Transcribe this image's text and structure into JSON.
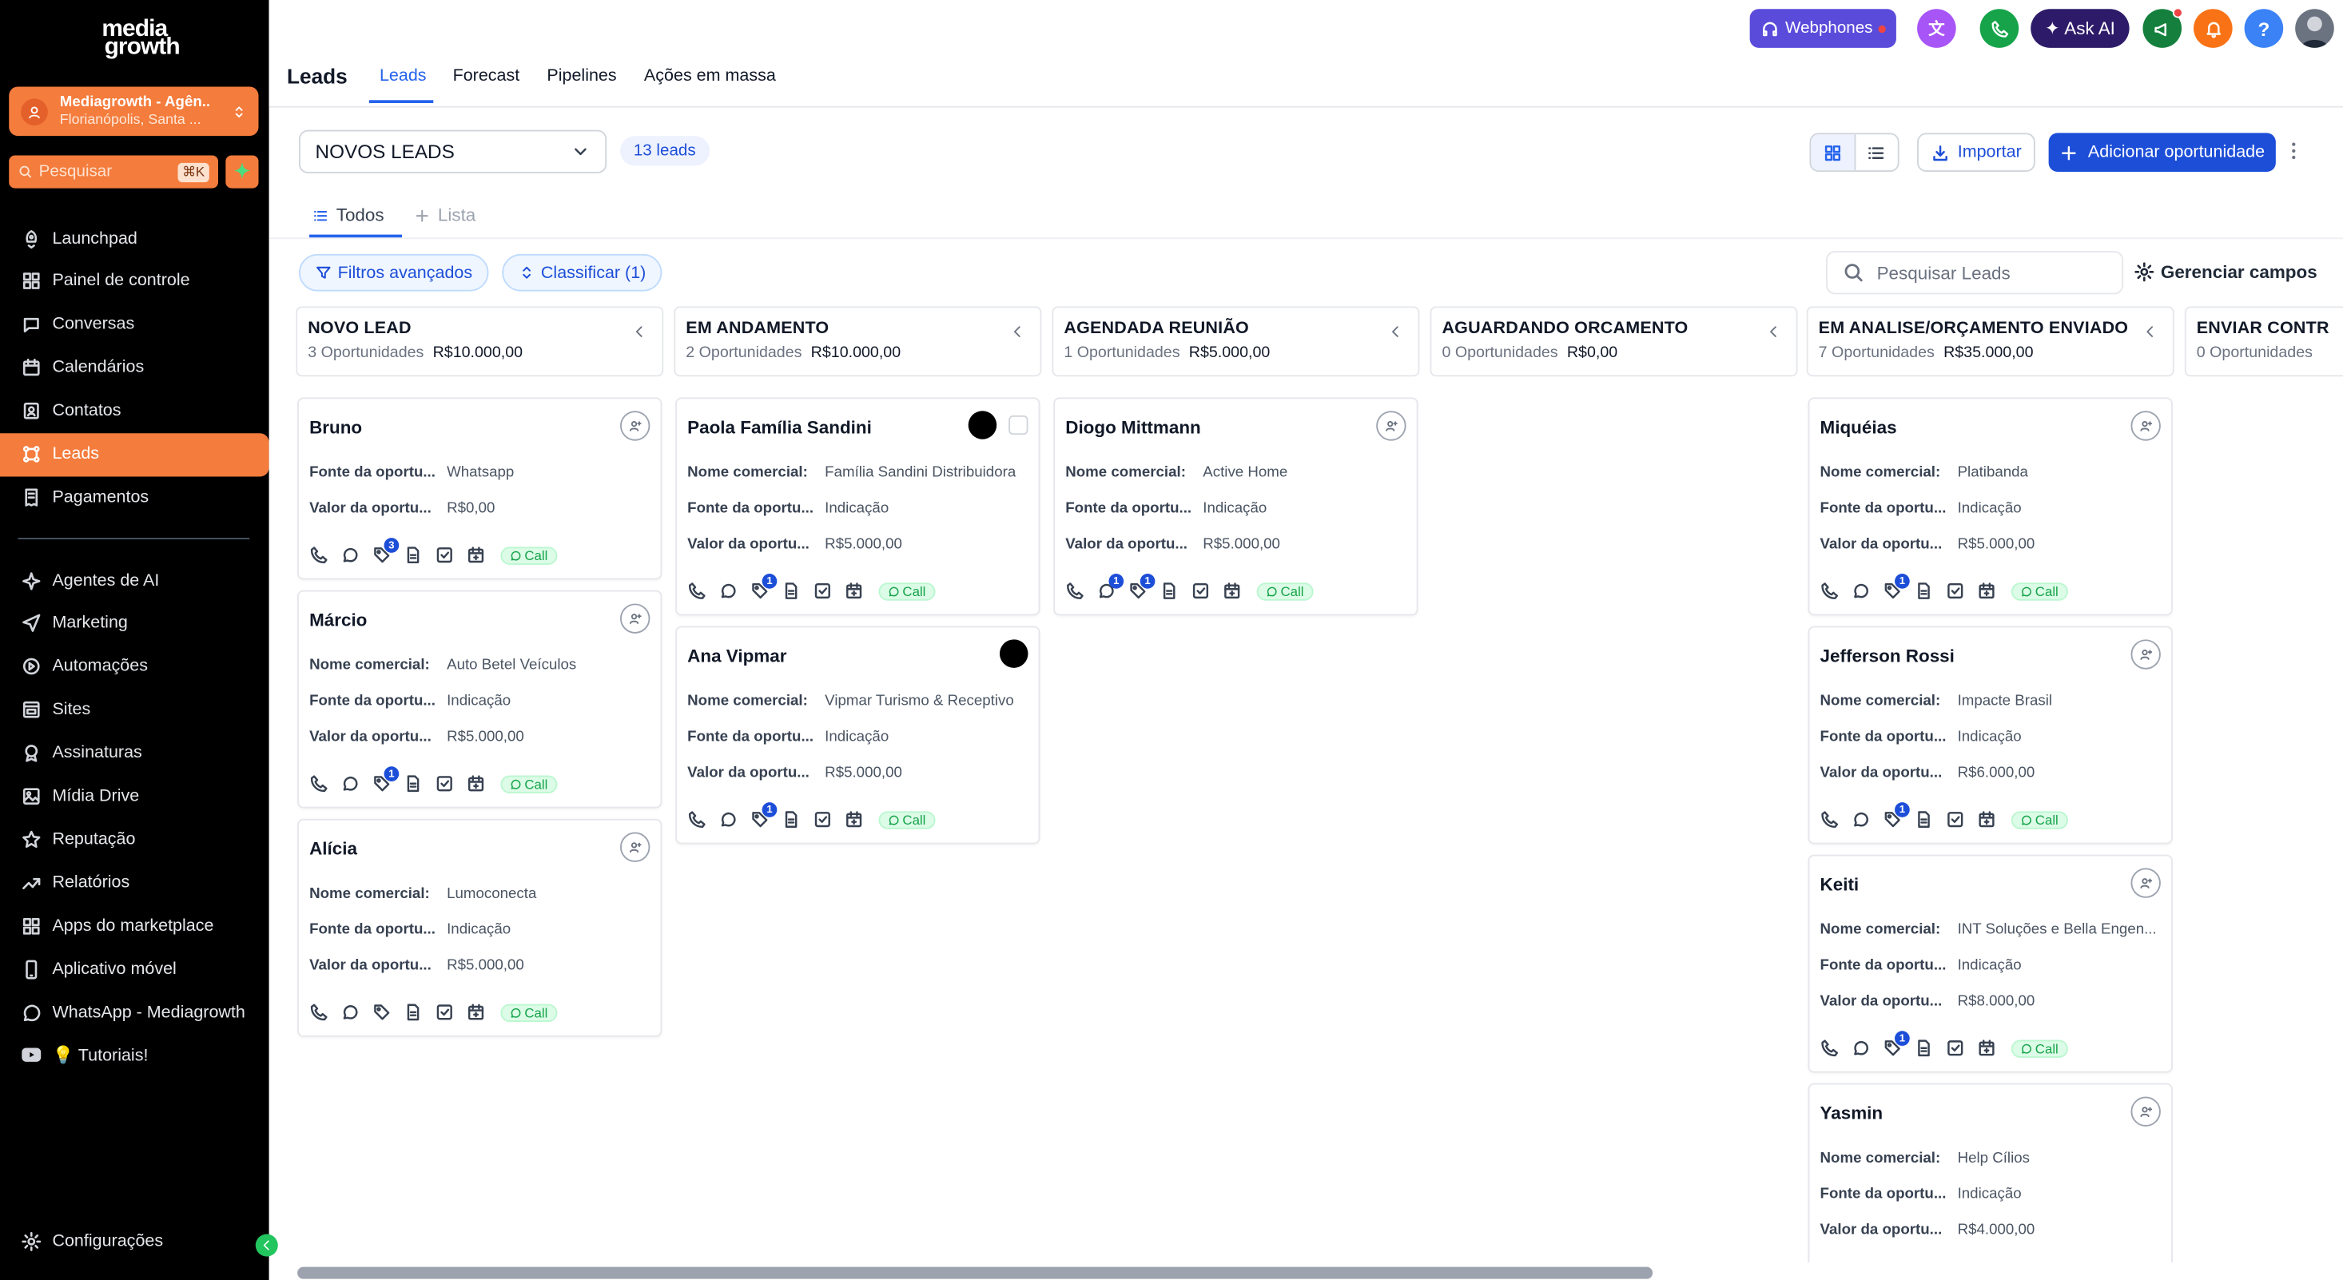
{
  "brand": {
    "line1": "media",
    "line2": "growth"
  },
  "account": {
    "name": "Mediagrowth - Agên...",
    "location": "Florianópolis, Santa ..."
  },
  "sidebar_search": {
    "placeholder": "Pesquisar",
    "shortcut": "⌘K"
  },
  "nav_top": [
    {
      "label": "Launchpad",
      "icon": "rocket-icon"
    },
    {
      "label": "Painel de controle",
      "icon": "grid-icon"
    },
    {
      "label": "Conversas",
      "icon": "chat-icon"
    },
    {
      "label": "Calendários",
      "icon": "calendar-icon"
    },
    {
      "label": "Contatos",
      "icon": "contacts-icon"
    },
    {
      "label": "Leads",
      "icon": "funnel-icon",
      "active": true
    },
    {
      "label": "Pagamentos",
      "icon": "receipt-icon"
    }
  ],
  "nav_bottom": [
    {
      "label": "Agentes de AI",
      "icon": "sparkle-icon"
    },
    {
      "label": "Marketing",
      "icon": "send-icon"
    },
    {
      "label": "Automações",
      "icon": "automation-icon"
    },
    {
      "label": "Sites",
      "icon": "sites-icon"
    },
    {
      "label": "Assinaturas",
      "icon": "badge-icon"
    },
    {
      "label": "Mídia Drive",
      "icon": "image-icon"
    },
    {
      "label": "Reputação",
      "icon": "star-icon"
    },
    {
      "label": "Relatórios",
      "icon": "trend-icon"
    },
    {
      "label": "Apps do marketplace",
      "icon": "apps-icon"
    },
    {
      "label": "Aplicativo móvel",
      "icon": "phone-device-icon"
    },
    {
      "label": "WhatsApp - Mediagrowth",
      "icon": "whatsapp-icon"
    },
    {
      "label": "💡 Tutoriais!",
      "icon": "youtube-icon"
    }
  ],
  "settings_label": "Configurações",
  "header": {
    "title": "Leads",
    "tabs": [
      "Leads",
      "Forecast",
      "Pipelines",
      "Ações em massa"
    ],
    "active_tab": "Leads"
  },
  "topbar": {
    "webphones": "Webphones",
    "ask_ai": "Ask AI"
  },
  "pipeline": {
    "selected": "NOVOS LEADS",
    "count": "13 leads"
  },
  "actions": {
    "import": "Importar",
    "add": "Adicionar oportunidade"
  },
  "subtabs": {
    "all": "Todos",
    "list": "Lista"
  },
  "filters": {
    "advanced": "Filtros avançados",
    "sort": "Classificar (1)"
  },
  "search_leads": {
    "placeholder": "Pesquisar Leads"
  },
  "manage_fields": "Gerenciar campos",
  "labels": {
    "nome": "Nome comercial:",
    "fonte": "Fonte da oportu...",
    "valor": "Valor da oportu...",
    "call": "Call"
  },
  "columns": [
    {
      "name": "NOVO LEAD",
      "count": "3 Oportunidades",
      "total": "R$10.000,00",
      "cards": [
        {
          "name": "Bruno",
          "fonte": "Whatsapp",
          "valor": "R$0,00",
          "tags_count": "3"
        },
        {
          "name": "Márcio",
          "nome": "Auto Betel Veículos",
          "fonte": "Indicação",
          "valor": "R$5.000,00",
          "tags_count": "1"
        },
        {
          "name": "Alícia",
          "nome": "Lumoconecta",
          "fonte": "Indicação",
          "valor": "R$5.000,00"
        }
      ]
    },
    {
      "name": "EM ANDAMENTO",
      "count": "2 Oportunidades",
      "total": "R$10.000,00",
      "cards": [
        {
          "name": "Paola Família Sandini",
          "nome": "Família Sandini Distribuidora",
          "fonte": "Indicação",
          "valor": "R$5.000,00",
          "tags_count": "1"
        },
        {
          "name": "Ana Vipmar",
          "nome": "Vipmar Turismo & Receptivo",
          "fonte": "Indicação",
          "valor": "R$5.000,00",
          "tags_count": "1"
        }
      ]
    },
    {
      "name": "AGENDADA REUNIÃO",
      "count": "1 Oportunidades",
      "total": "R$5.000,00",
      "cards": [
        {
          "name": "Diogo Mittmann",
          "nome": "Active Home",
          "fonte": "Indicação",
          "valor": "R$5.000,00",
          "msg_count": "1",
          "tags_count": "1"
        }
      ]
    },
    {
      "name": "AGUARDANDO ORCAMENTO",
      "count": "0 Oportunidades",
      "total": "R$0,00",
      "cards": []
    },
    {
      "name": "EM ANALISE/ORÇAMENTO ENVIADO",
      "count": "7 Oportunidades",
      "total": "R$35.000,00",
      "cards": [
        {
          "name": "Miquéias",
          "nome": "Platibanda",
          "fonte": "Indicação",
          "valor": "R$5.000,00",
          "tags_count": "1"
        },
        {
          "name": "Jefferson Rossi",
          "nome": "Impacte Brasil",
          "fonte": "Indicação",
          "valor": "R$6.000,00",
          "tags_count": "1"
        },
        {
          "name": "Keiti",
          "nome": "INT Soluções e Bella Engen...",
          "fonte": "Indicação",
          "valor": "R$8.000,00",
          "tags_count": "1"
        },
        {
          "name": "Yasmin",
          "nome": "Help Cílios",
          "fonte": "Indicação",
          "valor": "R$4.000,00"
        }
      ]
    },
    {
      "name": "ENVIAR CONTR",
      "count": "0 Oportunidades",
      "total": "",
      "cards": []
    }
  ]
}
